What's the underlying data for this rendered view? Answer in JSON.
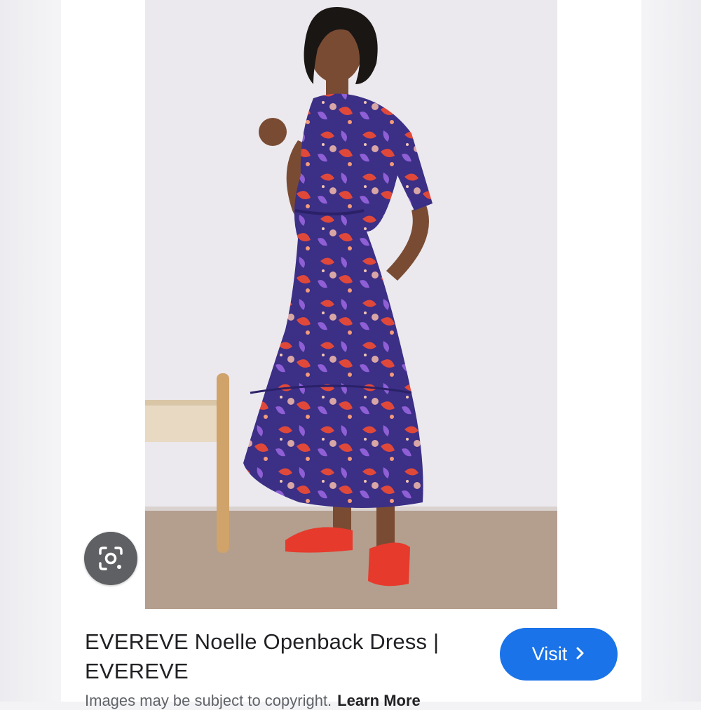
{
  "result": {
    "title": "EVEREVE Noelle Openback Dress | EVEREVE",
    "visit_label": "Visit",
    "notice": "Images may be subject to copyright.",
    "learn_more": "Learn More"
  },
  "icons": {
    "lens": "google-lens-icon",
    "visit_chevron": "chevron-right-icon"
  },
  "colors": {
    "visit_button": "#1a73e8",
    "lens_button": "#5f6064",
    "dress_base": "#3b2f86",
    "dress_accent": "#e0493a",
    "sandals": "#e63a2c"
  }
}
